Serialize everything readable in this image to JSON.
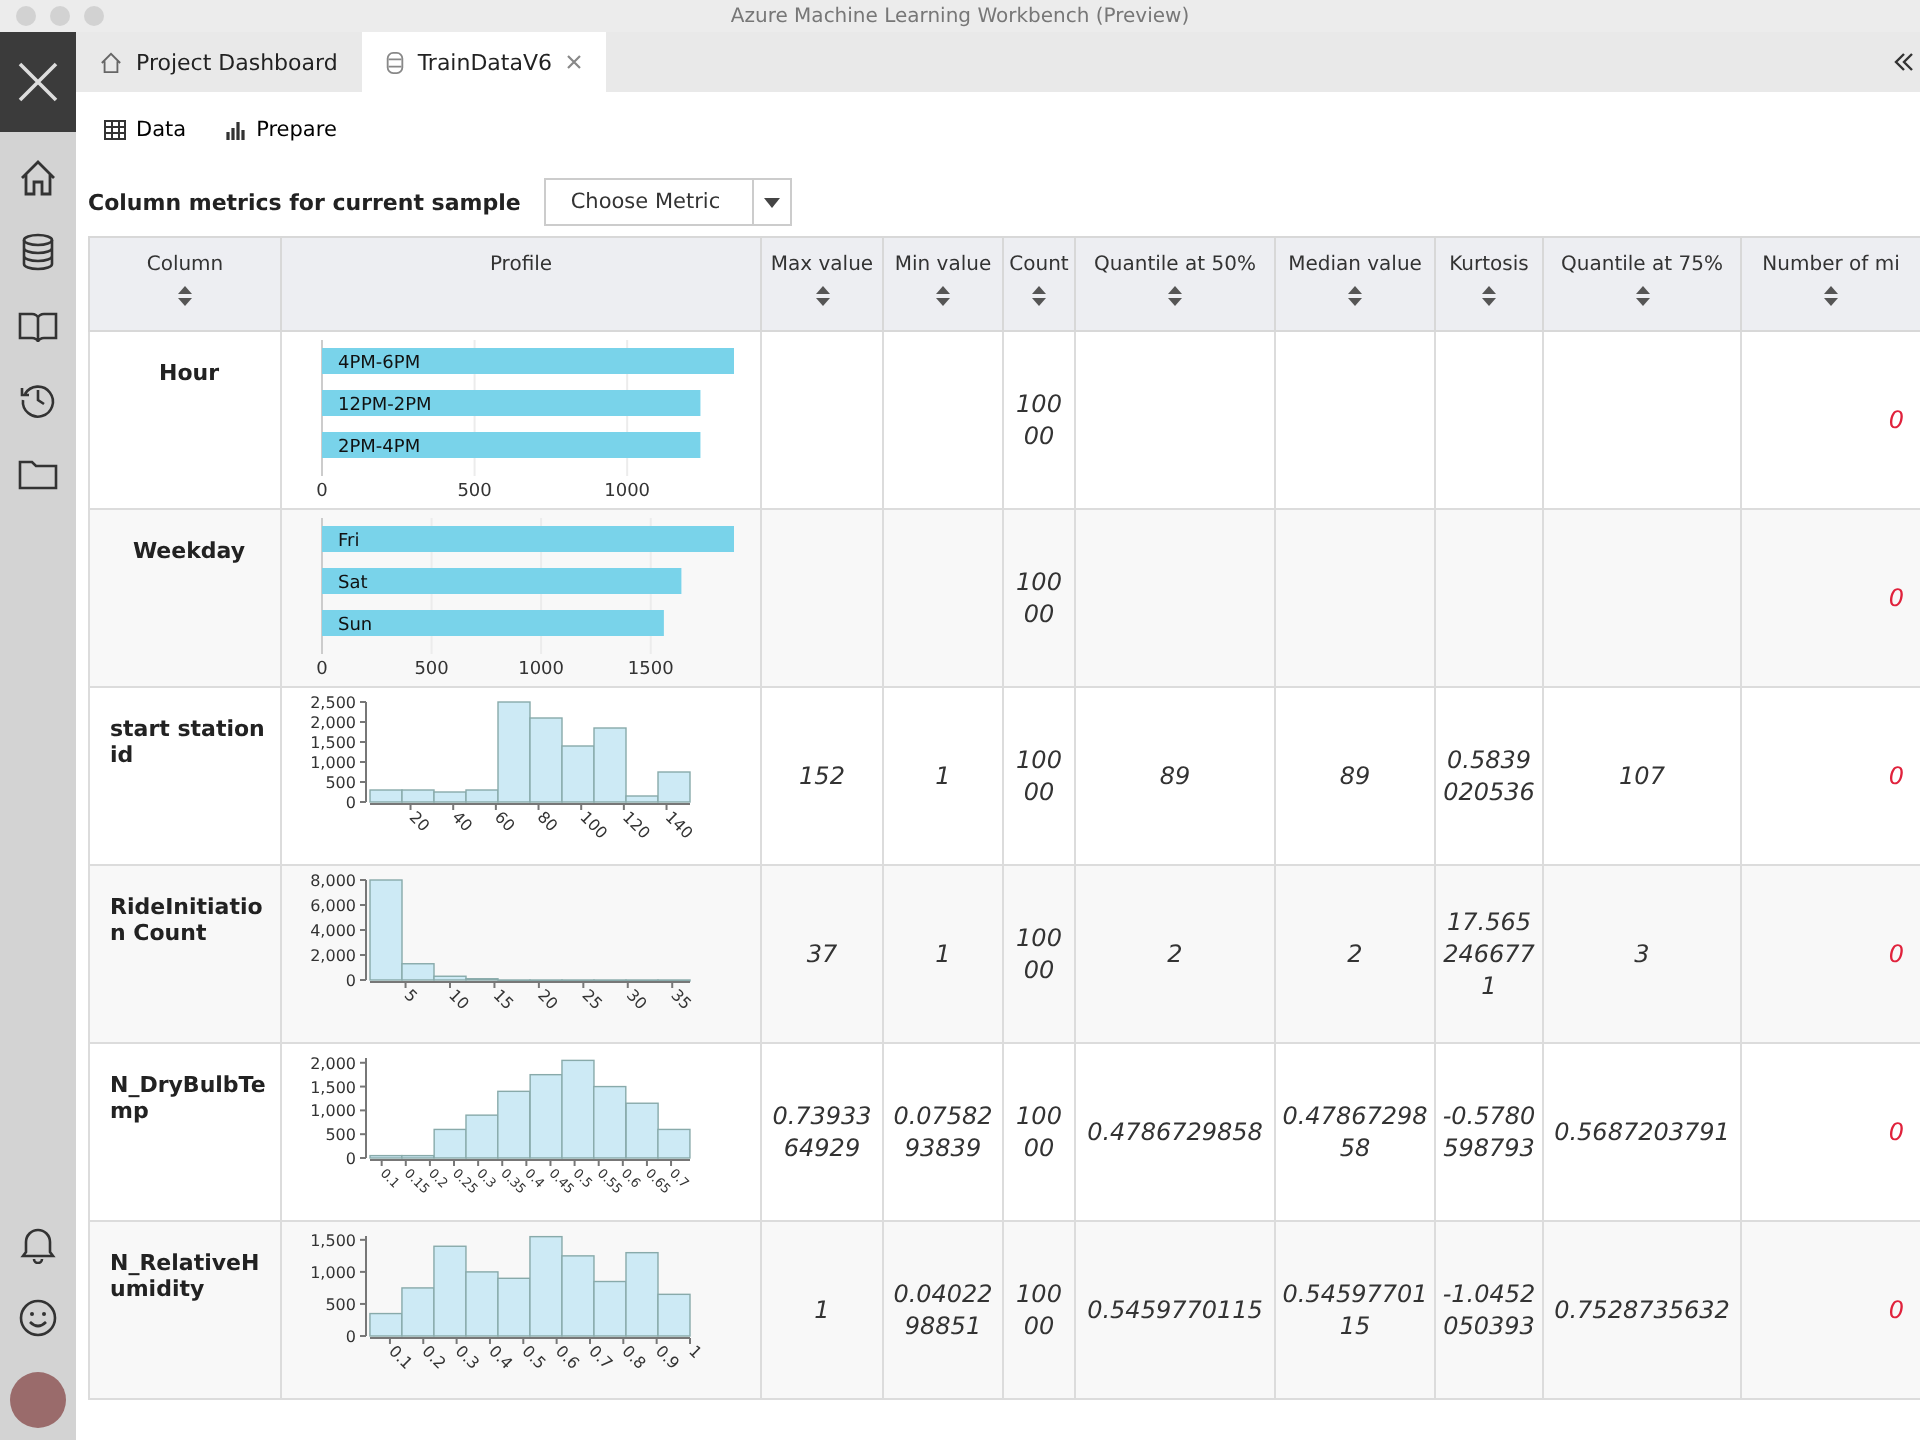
{
  "window": {
    "title": "Azure Machine Learning Workbench (Preview)"
  },
  "tabs": [
    {
      "label": "Project Dashboard",
      "kind": "dashboard",
      "selected": false,
      "closable": false
    },
    {
      "label": "TrainDataV6",
      "kind": "dataset",
      "selected": true,
      "closable": true
    }
  ],
  "toolbar": [
    {
      "label": "Data",
      "kind": "grid"
    },
    {
      "label": "Prepare",
      "kind": "chart"
    }
  ],
  "heading": "Column metrics for current sample",
  "metric_dropdown": {
    "value": "Choose Metric"
  },
  "table": {
    "columns": [
      {
        "label": "Column",
        "sortable": true
      },
      {
        "label": "Profile",
        "sortable": false
      },
      {
        "label": "Max value",
        "sortable": true
      },
      {
        "label": "Min value",
        "sortable": true
      },
      {
        "label": "Count",
        "sortable": true
      },
      {
        "label": "Quantile at 50%",
        "sortable": true
      },
      {
        "label": "Median value",
        "sortable": true
      },
      {
        "label": "Kurtosis",
        "sortable": true
      },
      {
        "label": "Quantile at 75%",
        "sortable": true
      },
      {
        "label": "Number of mi",
        "sortable": true
      }
    ],
    "rows": [
      {
        "name": "Hour",
        "kind": "categorical",
        "chart_data": {
          "type": "bar",
          "orientation": "horizontal",
          "grid": true,
          "categories": [
            "4PM-6PM",
            "12PM-2PM",
            "2PM-4PM"
          ],
          "values": [
            1350,
            1240,
            1240
          ],
          "xlim": [
            0,
            1350
          ],
          "xticks": [
            0,
            500,
            1000
          ]
        },
        "count": "10000",
        "number_of_mi": "0"
      },
      {
        "name": "Weekday",
        "kind": "categorical",
        "chart_data": {
          "type": "bar",
          "orientation": "horizontal",
          "grid": true,
          "categories": [
            "Fri",
            "Sat",
            "Sun"
          ],
          "values": [
            1880,
            1640,
            1560
          ],
          "xlim": [
            0,
            1880
          ],
          "xticks": [
            0,
            500,
            1000,
            1500
          ]
        },
        "count": "10000",
        "number_of_mi": "0"
      },
      {
        "name": "start station id",
        "kind": "numeric",
        "chart_data": {
          "type": "bar",
          "orientation": "vertical",
          "x": [
            8.5,
            23.5,
            38.5,
            53.5,
            68.5,
            83.5,
            98.5,
            113.5,
            128.5,
            143.5
          ],
          "values": [
            300,
            300,
            250,
            300,
            2500,
            2100,
            1400,
            1850,
            150,
            750
          ],
          "xlim": [
            1,
            151
          ],
          "ylim": [
            0,
            2500
          ],
          "xticks": [
            20,
            40,
            60,
            80,
            100,
            120,
            140
          ],
          "yticks": [
            {
              "value": 0,
              "label": "0"
            },
            {
              "value": 500,
              "label": "500"
            },
            {
              "value": 1000,
              "label": "1,000"
            },
            {
              "value": 1500,
              "label": "1,500"
            },
            {
              "value": 2000,
              "label": "2,000"
            },
            {
              "value": 2500,
              "label": "2,500"
            }
          ]
        },
        "max_value": "152",
        "min_value": "1",
        "count": "10000",
        "quantile_at_50": "89",
        "median_value": "89",
        "kurtosis": "0.5839020536",
        "quantile_at_75": "107",
        "number_of_mi": "0"
      },
      {
        "name": "RideInitiation Count",
        "kind": "numeric",
        "chart_data": {
          "type": "bar",
          "orientation": "vertical",
          "x": [
            2.8,
            6.4,
            10,
            13.6,
            17.2,
            20.8,
            24.4,
            28,
            31.6,
            35.2
          ],
          "values": [
            8000,
            1300,
            300,
            100,
            0,
            0,
            0,
            0,
            0,
            0
          ],
          "xlim": [
            1,
            37
          ],
          "ylim": [
            0,
            8000
          ],
          "xticks": [
            5,
            10,
            15,
            20,
            25,
            30,
            35
          ],
          "yticks": [
            {
              "value": 0,
              "label": "0"
            },
            {
              "value": 2000,
              "label": "2,000"
            },
            {
              "value": 4000,
              "label": "4,000"
            },
            {
              "value": 6000,
              "label": "6,000"
            },
            {
              "value": 8000,
              "label": "8,000"
            }
          ]
        },
        "max_value": "37",
        "min_value": "1",
        "count": "10000",
        "quantile_at_50": "2",
        "median_value": "2",
        "kurtosis": "17.5652466771",
        "quantile_at_75": "3",
        "number_of_mi": "0"
      },
      {
        "name": "N_DryBulbTemp",
        "kind": "numeric",
        "chart_data": {
          "type": "bar",
          "orientation": "vertical",
          "x": [
            0.109,
            0.175,
            0.242,
            0.308,
            0.374,
            0.441,
            0.507,
            0.573,
            0.64,
            0.706
          ],
          "values": [
            50,
            50,
            600,
            900,
            1400,
            1750,
            2050,
            1500,
            1150,
            600
          ],
          "xlim": [
            0.0758,
            0.7393
          ],
          "ylim": [
            0,
            2100
          ],
          "xticks": [
            0.1,
            0.15,
            0.2,
            0.25,
            0.3,
            0.35,
            0.4,
            0.45,
            0.5,
            0.55,
            0.6,
            0.65,
            0.7
          ],
          "yticks": [
            {
              "value": 0,
              "label": "0"
            },
            {
              "value": 500,
              "label": "500"
            },
            {
              "value": 1000,
              "label": "1,000"
            },
            {
              "value": 1500,
              "label": "1,500"
            },
            {
              "value": 2000,
              "label": "2,000"
            }
          ]
        },
        "max_value": "0.7393364929",
        "min_value": "0.0758293839",
        "count": "10000",
        "quantile_at_50": "0.4786729858",
        "median_value": "0.4786729858",
        "kurtosis": "-0.5780598793",
        "quantile_at_75": "0.5687203791",
        "number_of_mi": "0"
      },
      {
        "name": "N_RelativeHumidity",
        "kind": "numeric",
        "chart_data": {
          "type": "bar",
          "orientation": "vertical",
          "x": [
            0.088,
            0.184,
            0.28,
            0.376,
            0.472,
            0.568,
            0.664,
            0.76,
            0.856,
            0.952
          ],
          "values": [
            350,
            750,
            1400,
            1000,
            900,
            1550,
            1250,
            850,
            1300,
            650
          ],
          "xlim": [
            0.0402,
            1
          ],
          "ylim": [
            0,
            1560
          ],
          "xticks": [
            0.1,
            0.2,
            0.3,
            0.4,
            0.5,
            0.6,
            0.7,
            0.8,
            0.9,
            1
          ],
          "yticks": [
            {
              "value": 0,
              "label": "0"
            },
            {
              "value": 500,
              "label": "500"
            },
            {
              "value": 1000,
              "label": "1,000"
            },
            {
              "value": 1500,
              "label": "1,500"
            }
          ]
        },
        "max_value": "1",
        "min_value": "0.0402298851",
        "count": "10000",
        "quantile_at_50": "0.5459770115",
        "median_value": "0.5459770115",
        "kurtosis": "-1.0452050393",
        "quantile_at_75": "0.7528735632",
        "number_of_mi": "0"
      }
    ]
  }
}
